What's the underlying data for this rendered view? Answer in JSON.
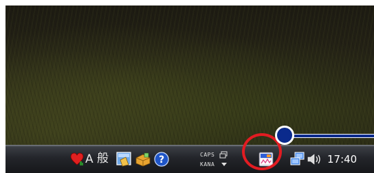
{
  "taskbar": {
    "language_indicator": "A",
    "ime_mode": "般",
    "caps_label": "CAPS",
    "kana_label": "KANA",
    "clock": "17:40"
  },
  "icons": {
    "notification": "alert-heart-icon",
    "ime_pad": "ime-pad-icon",
    "ime_tools": "ime-tools-icon",
    "help": "help-icon",
    "ime_settings": "ime-settings-icon",
    "dropdown": "chevron-down-icon",
    "highlighted_app": "tray-app-icon",
    "network": "network-icon",
    "volume": "volume-icon"
  },
  "colors": {
    "highlight_ring": "#e21c22",
    "callout": "#0a2a8c"
  }
}
